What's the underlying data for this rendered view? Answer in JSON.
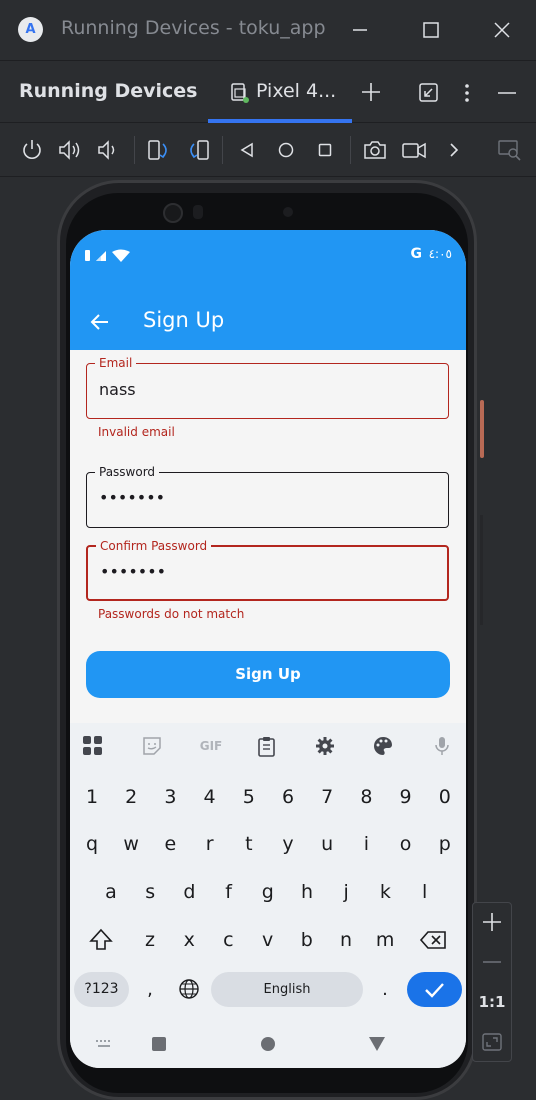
{
  "window": {
    "title": "Running Devices - toku_app",
    "logo_letter": "A"
  },
  "panel": {
    "title": "Running Devices",
    "device_tab": "Pixel 4..."
  },
  "toolbar_icons": [
    "power-icon",
    "volume-up-icon",
    "volume-down-icon",
    "rotate-left-icon",
    "rotate-right-icon",
    "back-icon",
    "home-icon",
    "overview-icon",
    "screenshot-icon",
    "screen-record-icon",
    "more-icon",
    "device-inspector-icon"
  ],
  "statusbar": {
    "time": "٤:٠٥",
    "google_icon": "G"
  },
  "appbar": {
    "title": "Sign Up"
  },
  "form": {
    "email": {
      "label": "Email",
      "value": "nass",
      "error": "Invalid email"
    },
    "password": {
      "label": "Password",
      "value": "•••••••"
    },
    "confirm_password": {
      "label": "Confirm Password",
      "value": "•••••••",
      "error": "Passwords do not match"
    },
    "submit_label": "Sign Up"
  },
  "keyboard": {
    "toolbar": [
      "apps-icon",
      "sticker-icon",
      "gif-icon",
      "clipboard-icon",
      "settings-icon",
      "theme-palette-icon",
      "mic-icon"
    ],
    "gif_label": "GIF",
    "row_numbers": [
      "1",
      "2",
      "3",
      "4",
      "5",
      "6",
      "7",
      "8",
      "9",
      "0"
    ],
    "row1": [
      "q",
      "w",
      "e",
      "r",
      "t",
      "y",
      "u",
      "i",
      "o",
      "p"
    ],
    "row2": [
      "a",
      "s",
      "d",
      "f",
      "g",
      "h",
      "j",
      "k",
      "l"
    ],
    "row3": [
      "z",
      "x",
      "c",
      "v",
      "b",
      "n",
      "m"
    ],
    "symbols_label": "?123",
    "comma": ",",
    "space_label": "English",
    "period": "."
  },
  "zoom": {
    "ratio_label": "1:1"
  },
  "colors": {
    "app_blue": "#2196f3",
    "error_red": "#b3261e",
    "ide_bg": "#2b2d30",
    "accent": "#3574f0"
  }
}
